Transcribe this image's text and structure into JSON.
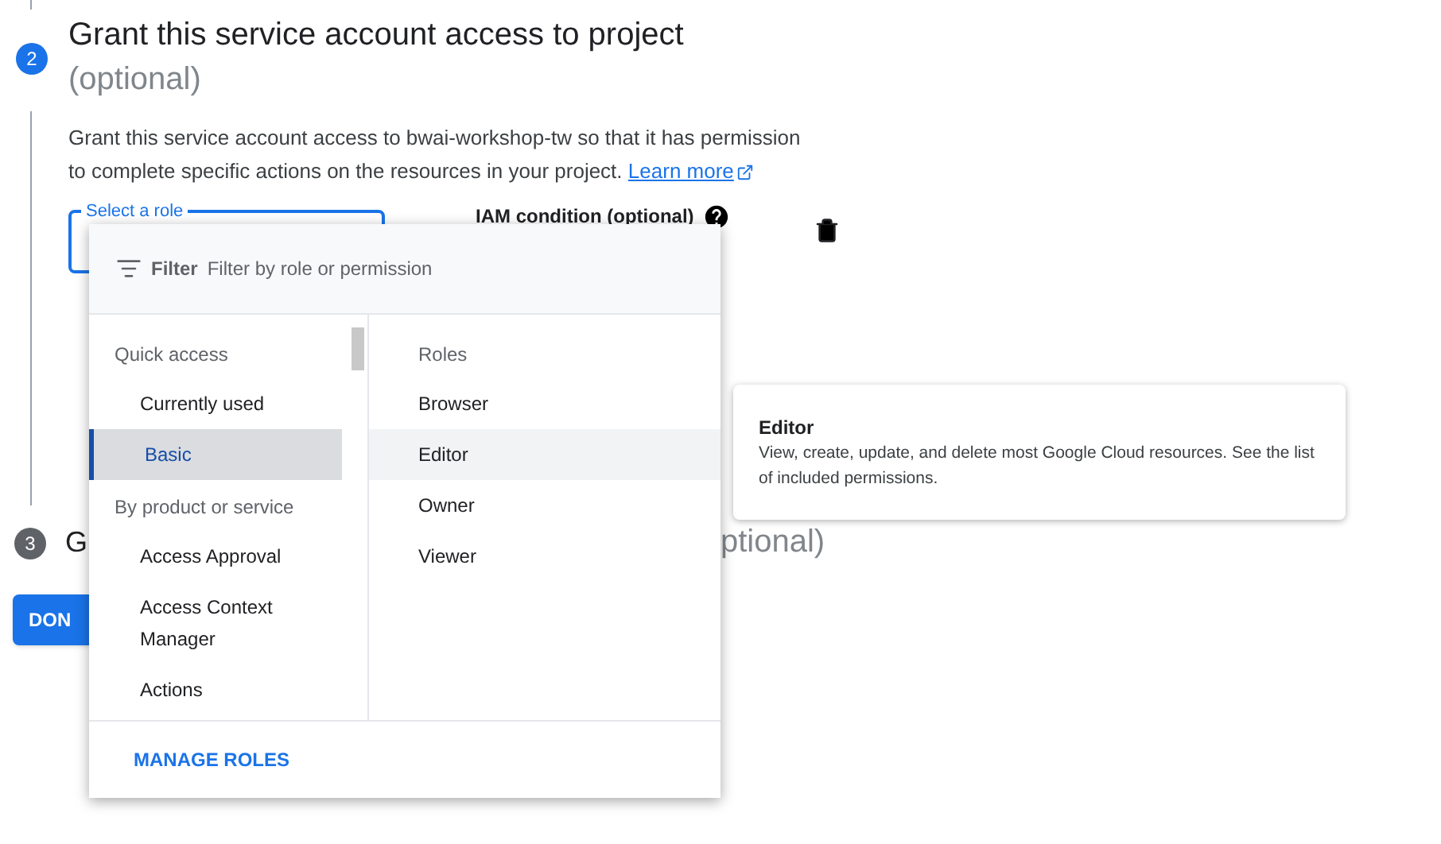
{
  "step2": {
    "number": "2",
    "title": "Grant this service account access to project",
    "optional": "(optional)",
    "description": "Grant this service account access to bwai-workshop-tw so that it has permission to complete specific actions on the resources in your project.",
    "link": "Learn more"
  },
  "role_field": {
    "label": "Select a role"
  },
  "iam_condition": {
    "label": "IAM condition (optional)"
  },
  "step3": {
    "number": "3",
    "title_start": "G",
    "title_end": "ptional)"
  },
  "done_button": "DON",
  "dropdown": {
    "filter_label": "Filter",
    "placeholder": "Filter by role or permission",
    "categories": [
      {
        "kind": "header",
        "label": "Quick access"
      },
      {
        "kind": "item",
        "label": "Currently used",
        "selected": false
      },
      {
        "kind": "item",
        "label": "Basic",
        "selected": true
      },
      {
        "kind": "header",
        "label": "By product or service"
      },
      {
        "kind": "item",
        "label": "Access Approval",
        "selected": false
      },
      {
        "kind": "item",
        "label": "Access Context Manager",
        "selected": false
      },
      {
        "kind": "item",
        "label": "Actions",
        "selected": false
      }
    ],
    "roles_header": "Roles",
    "roles": [
      {
        "label": "Browser",
        "hovered": false
      },
      {
        "label": "Editor",
        "hovered": true
      },
      {
        "label": "Owner",
        "hovered": false
      },
      {
        "label": "Viewer",
        "hovered": false
      }
    ],
    "footer_button": "MANAGE ROLES"
  },
  "tooltip": {
    "title": "Editor",
    "text": "View, create, update, and delete most Google Cloud resources. See the list of included permissions."
  }
}
